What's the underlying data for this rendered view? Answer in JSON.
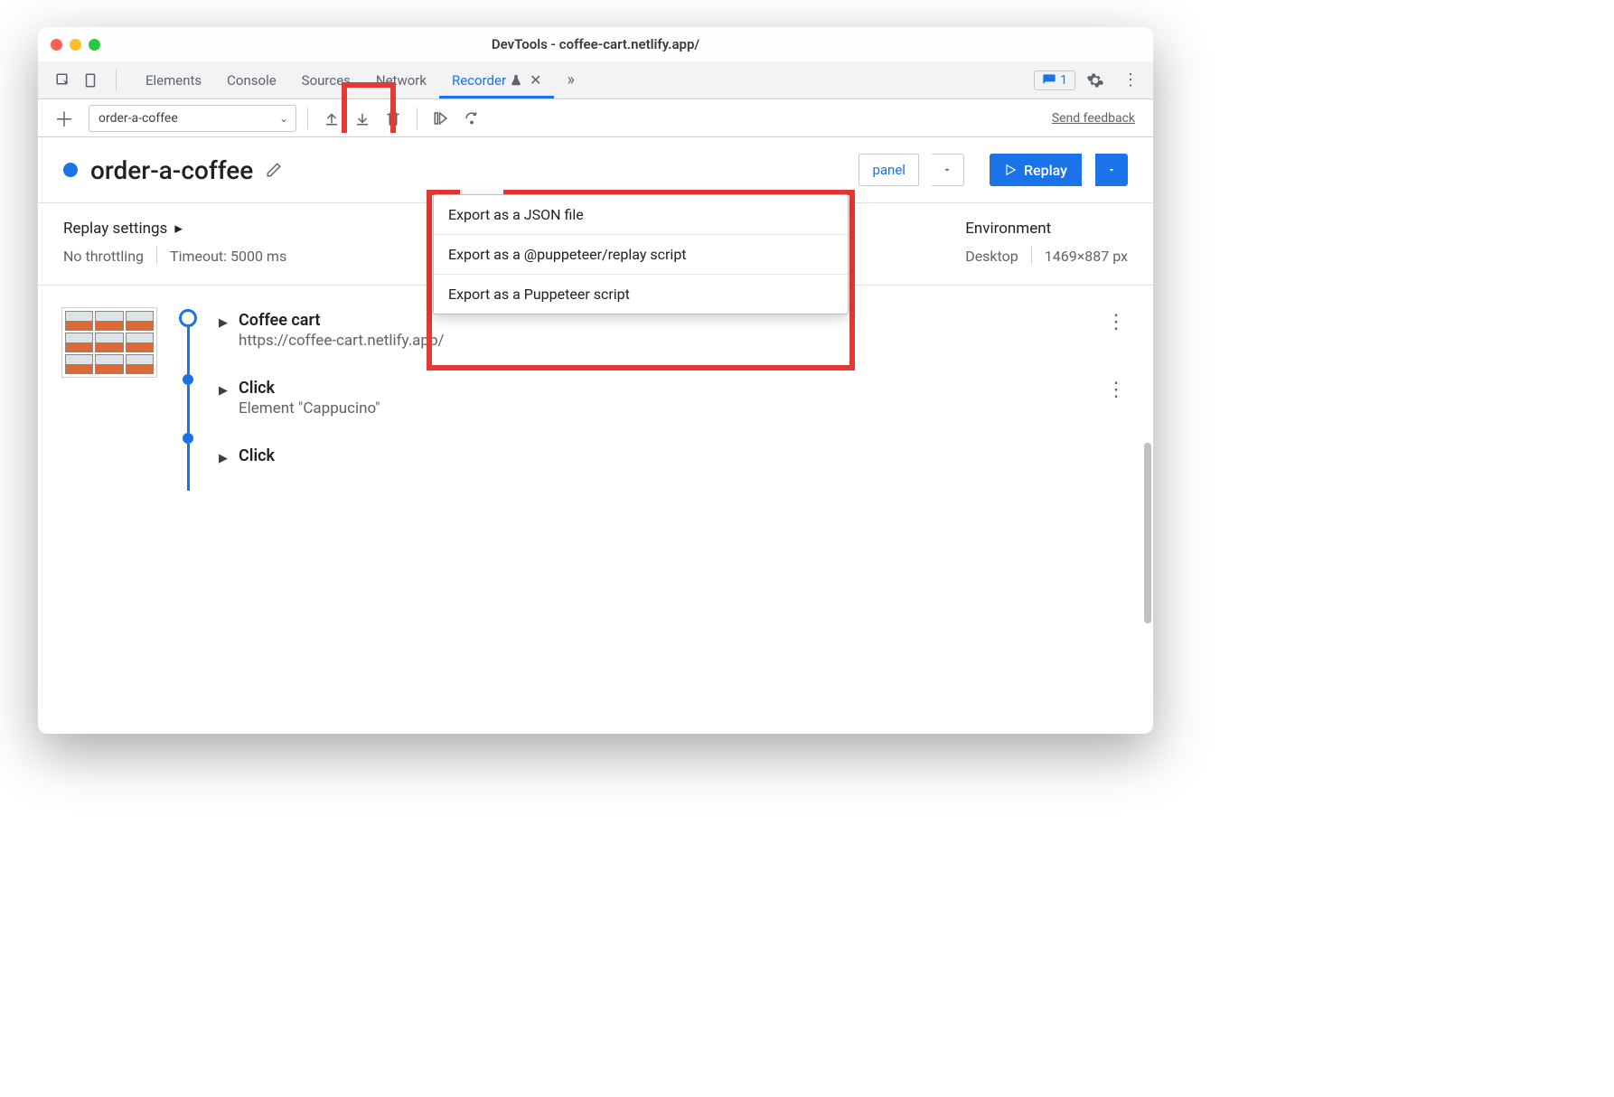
{
  "window": {
    "title": "DevTools - coffee-cart.netlify.app/"
  },
  "tabs": {
    "list": [
      "Elements",
      "Console",
      "Sources",
      "Network",
      "Recorder"
    ],
    "active": "Recorder",
    "issues_badge": "1"
  },
  "toolbar": {
    "recording_name": "order-a-coffee",
    "feedback": "Send feedback"
  },
  "export_menu": {
    "items": [
      "Export as a JSON file",
      "Export as a @puppeteer/replay script",
      "Export as a Puppeteer script"
    ]
  },
  "recording": {
    "title": "order-a-coffee",
    "panel_button": "panel",
    "replay_button": "Replay"
  },
  "settings": {
    "replay_head": "Replay settings",
    "throttling": "No throttling",
    "timeout": "Timeout: 5000 ms",
    "env_head": "Environment",
    "device": "Desktop",
    "viewport": "1469×887 px"
  },
  "steps": [
    {
      "title": "Coffee cart",
      "sub": "https://coffee-cart.netlify.app/"
    },
    {
      "title": "Click",
      "sub": "Element \"Cappucino\""
    },
    {
      "title": "Click",
      "sub": ""
    }
  ]
}
